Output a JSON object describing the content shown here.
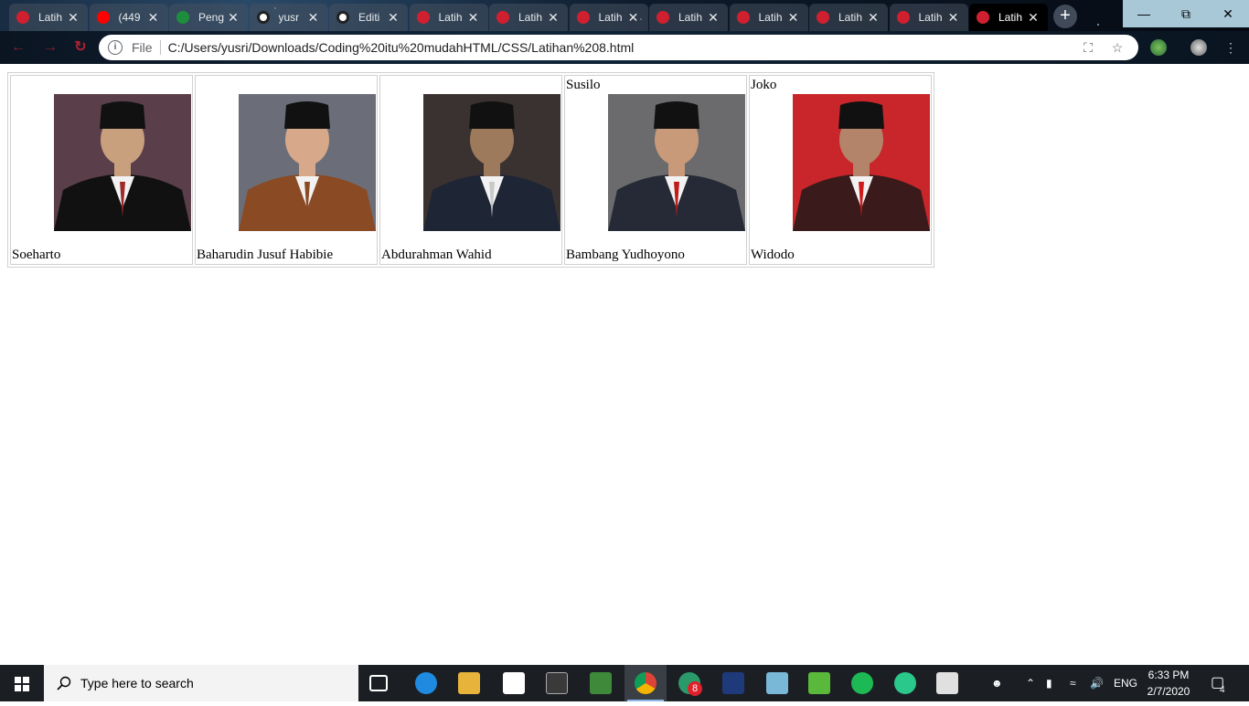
{
  "browser": {
    "tabs": [
      {
        "title": "Latih",
        "favicon": "red-circle-icon",
        "active": false
      },
      {
        "title": "(449",
        "favicon": "youtube-icon",
        "active": false
      },
      {
        "title": "Peng",
        "favicon": "classroom-icon",
        "active": false
      },
      {
        "title": "yusr",
        "favicon": "github-icon",
        "active": false
      },
      {
        "title": "Editi",
        "favicon": "github-icon",
        "active": false
      },
      {
        "title": "Latih",
        "favicon": "red-circle-icon",
        "active": false
      },
      {
        "title": "Latih",
        "favicon": "red-circle-icon",
        "active": false
      },
      {
        "title": "Latih",
        "favicon": "red-circle-icon",
        "active": false
      },
      {
        "title": "Latih",
        "favicon": "red-circle-icon",
        "active": false
      },
      {
        "title": "Latih",
        "favicon": "red-circle-icon",
        "active": false
      },
      {
        "title": "Latih",
        "favicon": "red-circle-icon",
        "active": false
      },
      {
        "title": "Latih",
        "favicon": "red-circle-icon",
        "active": false
      },
      {
        "title": "Latih",
        "favicon": "red-circle-icon",
        "active": true
      }
    ],
    "address": {
      "scheme_label": "File",
      "url": "C:/Users/yusri/Downloads/Coding%20itu%20mudahHTML/CSS/Latihan%208.html"
    }
  },
  "page": {
    "presidents": [
      {
        "top_label": "",
        "bottom_label": "Soeharto",
        "bg": "#5a3f4a",
        "suit": "#111111",
        "skin": "#c9a07e",
        "accent": "#a02a2a"
      },
      {
        "top_label": "",
        "bottom_label": "Baharudin Jusuf Habibie",
        "bg": "#6b6e78",
        "suit": "#8a4a24",
        "skin": "#d7a98a",
        "accent": "#8a4a24"
      },
      {
        "top_label": "",
        "bottom_label": "Abdurahman Wahid",
        "bg": "#3a3230",
        "suit": "#1e2636",
        "skin": "#9e7a5c",
        "accent": "#c9c9c9"
      },
      {
        "top_label": "Susilo",
        "bottom_label": "Bambang Yudhoyono",
        "bg": "#6b6a6c",
        "suit": "#262a36",
        "skin": "#c89a7a",
        "accent": "#c01a1a"
      },
      {
        "top_label": "Joko",
        "bottom_label": "Widodo",
        "bg": "#c8262a",
        "suit": "#3a1a1a",
        "skin": "#b3846a",
        "accent": "#d01a1a"
      }
    ]
  },
  "taskbar": {
    "search_placeholder": "Type here to search",
    "language": "ENG",
    "time": "6:33 PM",
    "date": "2/7/2020",
    "whatsapp_badge": "8",
    "notification_count": "4"
  }
}
